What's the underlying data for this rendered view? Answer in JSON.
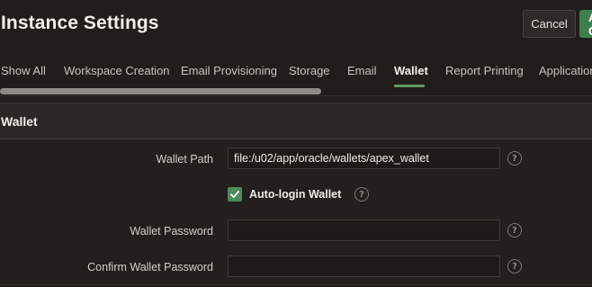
{
  "header": {
    "title": "Instance Settings",
    "cancel_label": "Cancel",
    "apply_label": "Apply Changes"
  },
  "tabs": [
    {
      "label": "Show All",
      "active": false
    },
    {
      "label": "Workspace Creation",
      "active": false
    },
    {
      "label": "Email Provisioning",
      "active": false
    },
    {
      "label": "Storage",
      "active": false
    },
    {
      "label": "Email",
      "active": false
    },
    {
      "label": "Wallet",
      "active": true
    },
    {
      "label": "Report Printing",
      "active": false
    },
    {
      "label": "Application",
      "active": false
    }
  ],
  "region": {
    "title": "Wallet"
  },
  "form": {
    "wallet_path": {
      "label": "Wallet Path",
      "value": "file:/u02/app/oracle/wallets/apex_wallet"
    },
    "auto_login": {
      "label": "Auto-login Wallet",
      "checked": true
    },
    "wallet_password": {
      "label": "Wallet Password",
      "value": ""
    },
    "confirm_wallet_password": {
      "label": "Confirm Wallet Password",
      "value": ""
    }
  },
  "icons": {
    "help": "help-icon",
    "check": "check-icon"
  },
  "colors": {
    "background": "#211d1a",
    "accent_green": "#3f7f4f",
    "active_tab_underline": "#5f9a64"
  }
}
